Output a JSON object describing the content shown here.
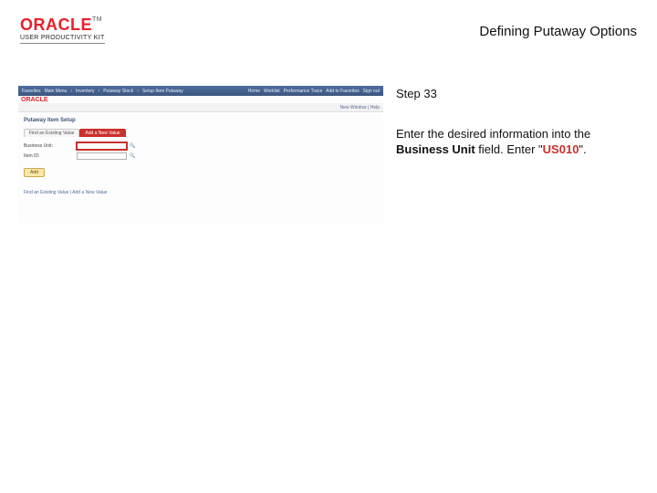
{
  "header": {
    "brand": "ORACLE",
    "tm": "TM",
    "subbrand": "USER PRODUCTIVITY KIT",
    "title": "Defining Putaway Options"
  },
  "screenshot": {
    "breadcrumb": [
      "Favorites",
      "Main Menu",
      "Inventory",
      "Putaway Stock",
      "Setup Item Putaway"
    ],
    "nav_links": [
      "Home",
      "Worklist",
      "Performance Trace",
      "Add to Favorites",
      "Sign out"
    ],
    "window_label": "New Window | Help",
    "page_heading": "Putaway Item Setup",
    "tabs": [
      "Find an Existing Value",
      "Add a New Value"
    ],
    "tab_active_index": 1,
    "fields": {
      "business_unit": {
        "label": "Business Unit:",
        "value": ""
      },
      "item_id": {
        "label": "Item ID:",
        "value": ""
      }
    },
    "add_button": "Add",
    "footer_links": "Find an Existing Value | Add a New Value",
    "mini_brand": "ORACLE"
  },
  "instructions": {
    "step_label": "Step 33",
    "line1_a": "Enter the desired information into the ",
    "line1_bold": "Business Unit",
    "line1_b": " field. Enter \"",
    "line1_red": "US010",
    "line1_c": "\"."
  }
}
